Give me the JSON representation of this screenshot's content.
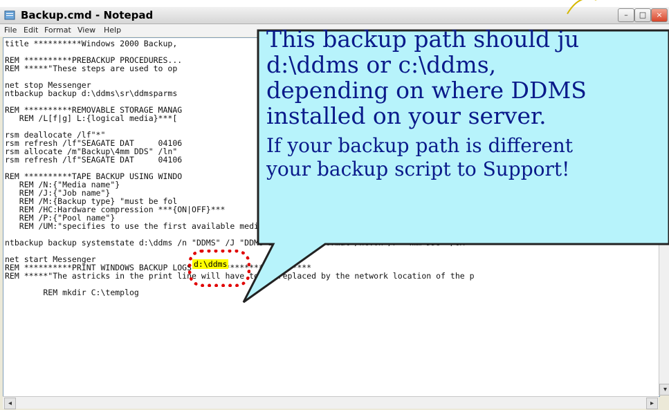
{
  "window": {
    "title": "Backup.cmd - Notepad",
    "menu": [
      "File",
      "Edit",
      "Format",
      "View",
      "Help"
    ]
  },
  "editor_lines": [
    "title **********Windows 2000 Backup,",
    "",
    "REM **********PREBACKUP PROCEDURES...",
    "REM *****\"These steps are used to op",
    "",
    "net stop Messenger",
    "ntbackup backup d:\\ddms\\sr\\ddmsparms",
    "",
    "REM **********REMOVABLE STORAGE MANAG",
    "   REM /L[f|g] L:{logical media}***[",
    "",
    "rsm deallocate /lf\"*\"",
    "rsm refresh /lf\"SEAGATE DAT     04106",
    "rsm allocate /m\"Backup\\4mm DDS\" /ln\"",
    "rsm refresh /lf\"SEAGATE DAT     04106",
    "",
    "REM **********TAPE BACKUP USING WINDO",
    "   REM /N:{\"Media name\"}",
    "   REM /J:{\"Job name\"}",
    "   REM /M:{Backup type} \"must be fol",
    "   REM /HC:Hardware compression ***{ON|OFF}***",
    "   REM /P:{\"Pool name\"}",
    "   REM /UM:\"specifies to use the first available media.\"",
    "",
    "ntbackup backup systemstate d:\\ddms /n \"DDMS\" /J \"DDMS Backup\" /m normal /hc:on /P \"4mm DDS\" /UM",
    "",
    "net start Messenger",
    "REM **********PRINT WINDOWS BACKUP LOGS*************************",
    "REM *****\"The astricks in the print line will have to be replaced by the network location of the p",
    "",
    "        REM mkdir C:\\templog"
  ],
  "highlighted_path": "d:\\ddms",
  "callout": {
    "line1": "This backup path should ju",
    "line2": "d:\\ddms or c:\\ddms,",
    "line3": "depending on where DDMS",
    "line4": "installed on your server.",
    "line5": "If your backup path is different",
    "line6": "your backup script to Support!",
    "fill_color": "#b7f3fb",
    "text_color": "#0a1a8a",
    "highlight_color": "#ffff00",
    "marker_color": "#e00000"
  },
  "icons": [
    "notepad-icon",
    "minimize-icon",
    "maximize-icon",
    "close-icon",
    "scroll-left-icon",
    "scroll-right-icon",
    "scroll-down-icon"
  ]
}
